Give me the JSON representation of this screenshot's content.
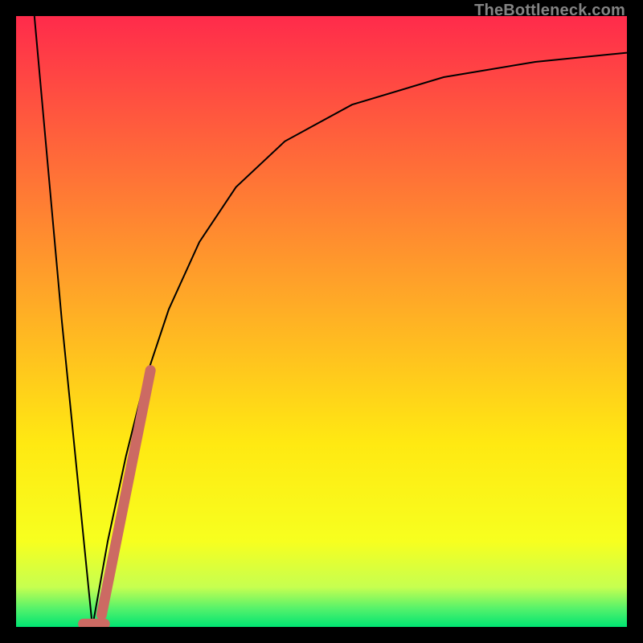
{
  "watermark": "TheBottleneck.com",
  "chart_data": {
    "type": "line",
    "title": "",
    "xlabel": "",
    "ylabel": "",
    "xlim": [
      0,
      100
    ],
    "ylim": [
      0,
      100
    ],
    "background_gradient": {
      "stops": [
        {
          "pos": 0.0,
          "color": "#ff2b4b"
        },
        {
          "pos": 0.45,
          "color": "#ffa528"
        },
        {
          "pos": 0.7,
          "color": "#ffe912"
        },
        {
          "pos": 0.86,
          "color": "#f7ff1f"
        },
        {
          "pos": 0.935,
          "color": "#c6ff50"
        },
        {
          "pos": 0.97,
          "color": "#55f26b"
        },
        {
          "pos": 1.0,
          "color": "#00e472"
        }
      ]
    },
    "series": [
      {
        "name": "left-descent",
        "stroke": "#000000",
        "width": 2,
        "x": [
          3.0,
          7.5,
          12.5
        ],
        "y": [
          100.0,
          50.0,
          0.0
        ]
      },
      {
        "name": "right-ascent",
        "stroke": "#000000",
        "width": 2,
        "x": [
          12.5,
          15.0,
          18.0,
          21.0,
          25.0,
          30.0,
          36.0,
          44.0,
          55.0,
          70.0,
          85.0,
          100.0
        ],
        "y": [
          0.0,
          14.0,
          28.0,
          40.0,
          52.0,
          63.0,
          72.0,
          79.5,
          85.5,
          90.0,
          92.5,
          94.0
        ]
      },
      {
        "name": "highlight-band",
        "stroke": "#cc6a63",
        "width": 13,
        "linecap": "round",
        "x": [
          14.0,
          22.0
        ],
        "y": [
          2.0,
          42.0
        ]
      },
      {
        "name": "highlight-foot",
        "stroke": "#cc6a63",
        "width": 13,
        "linecap": "round",
        "x": [
          11.0,
          14.5
        ],
        "y": [
          0.5,
          0.5
        ]
      }
    ]
  }
}
